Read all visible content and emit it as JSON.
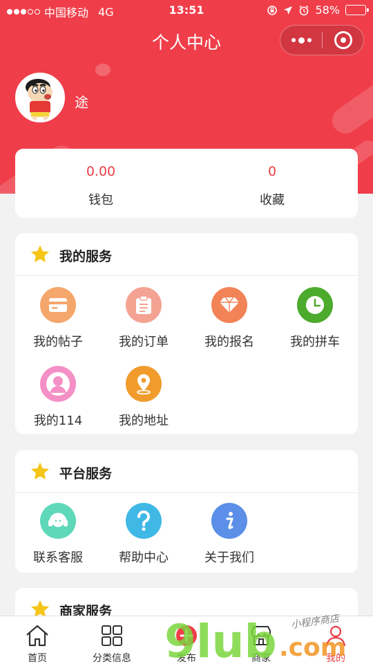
{
  "status_bar": {
    "carrier": "中国移动",
    "network": "4G",
    "time": "13:51",
    "battery": "58%",
    "battery_level": 0.58,
    "signal_bars": 3,
    "signal_total": 5
  },
  "nav": {
    "title": "个人中心"
  },
  "profile": {
    "username": "途"
  },
  "stats": [
    {
      "value": "0.00",
      "label": "钱包"
    },
    {
      "value": "0",
      "label": "收藏"
    }
  ],
  "sections": {
    "my_services": {
      "title": "我的服务",
      "items": [
        {
          "label": "我的帖子",
          "icon": "card-icon",
          "color": "#f5a66b"
        },
        {
          "label": "我的订单",
          "icon": "clipboard-icon",
          "color": "#f4a393"
        },
        {
          "label": "我的报名",
          "icon": "diamond-icon",
          "color": "#f28357"
        },
        {
          "label": "我的拼车",
          "icon": "clock-icon",
          "color": "#4caa2c"
        },
        {
          "label": "我的114",
          "icon": "user-icon",
          "color": "#f590c6"
        },
        {
          "label": "我的地址",
          "icon": "location-icon",
          "color": "#f19b2c"
        }
      ]
    },
    "platform_services": {
      "title": "平台服务",
      "items": [
        {
          "label": "联系客服",
          "icon": "headset-icon",
          "color": "#5ed8b9"
        },
        {
          "label": "帮助中心",
          "icon": "question-icon",
          "color": "#3fb8e6"
        },
        {
          "label": "关于我们",
          "icon": "info-icon",
          "color": "#5b8fe8"
        }
      ]
    },
    "merchant_services": {
      "title": "商家服务"
    }
  },
  "tabbar": [
    {
      "label": "首页",
      "icon": "home-icon",
      "active": false
    },
    {
      "label": "分类信息",
      "icon": "grid-icon",
      "active": false
    },
    {
      "label": "发布",
      "icon": "plus-icon",
      "active": false
    },
    {
      "label": "商家",
      "icon": "store-icon",
      "active": false
    },
    {
      "label": "我的",
      "icon": "person-icon",
      "active": true
    }
  ],
  "watermark": {
    "text": "9lub",
    "suffix": ".com",
    "tagline": "小程序商店"
  },
  "colors": {
    "brand_red": "#ef3e4a",
    "value_red": "#e83e45",
    "star_yellow": "#f5c518",
    "watermark_green": "#7bd63e"
  }
}
